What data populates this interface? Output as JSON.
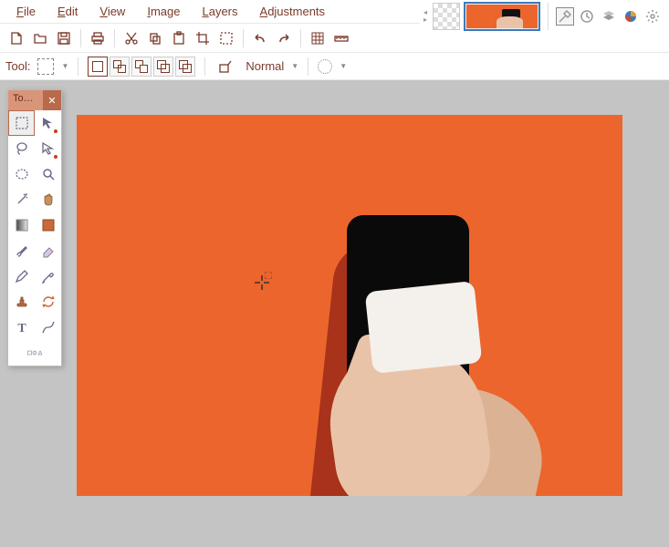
{
  "menu": {
    "items": [
      {
        "label": "File",
        "underline": "F"
      },
      {
        "label": "Edit",
        "underline": "E"
      },
      {
        "label": "View",
        "underline": "V"
      },
      {
        "label": "Image",
        "underline": "I"
      },
      {
        "label": "Layers",
        "underline": "L"
      },
      {
        "label": "Adjustments",
        "underline": "A"
      }
    ]
  },
  "toolbar": {
    "buttons": [
      "new",
      "open",
      "save",
      "print",
      "cut",
      "copy",
      "paste",
      "crop",
      "deselect",
      "undo",
      "redo",
      "grid",
      "ruler"
    ]
  },
  "options_bar": {
    "tool_label": "Tool:",
    "blend_mode": "Normal"
  },
  "topstrip": {
    "icons": [
      "hammer",
      "history",
      "layers",
      "pie-colors",
      "gear"
    ]
  },
  "tools_panel": {
    "title": "To…",
    "tools": [
      "rectangle-select",
      "move",
      "lasso",
      "polygon-lasso",
      "ellipse-select",
      "zoom",
      "magic-wand",
      "pan",
      "gradient",
      "fill",
      "brush",
      "eraser",
      "pencil",
      "color-picker",
      "clone-stamp",
      "recolor",
      "text",
      "line-curve",
      "shapes"
    ]
  },
  "canvas": {
    "bg_color": "#ec652c",
    "subject": "hands-cleaning-phone"
  }
}
